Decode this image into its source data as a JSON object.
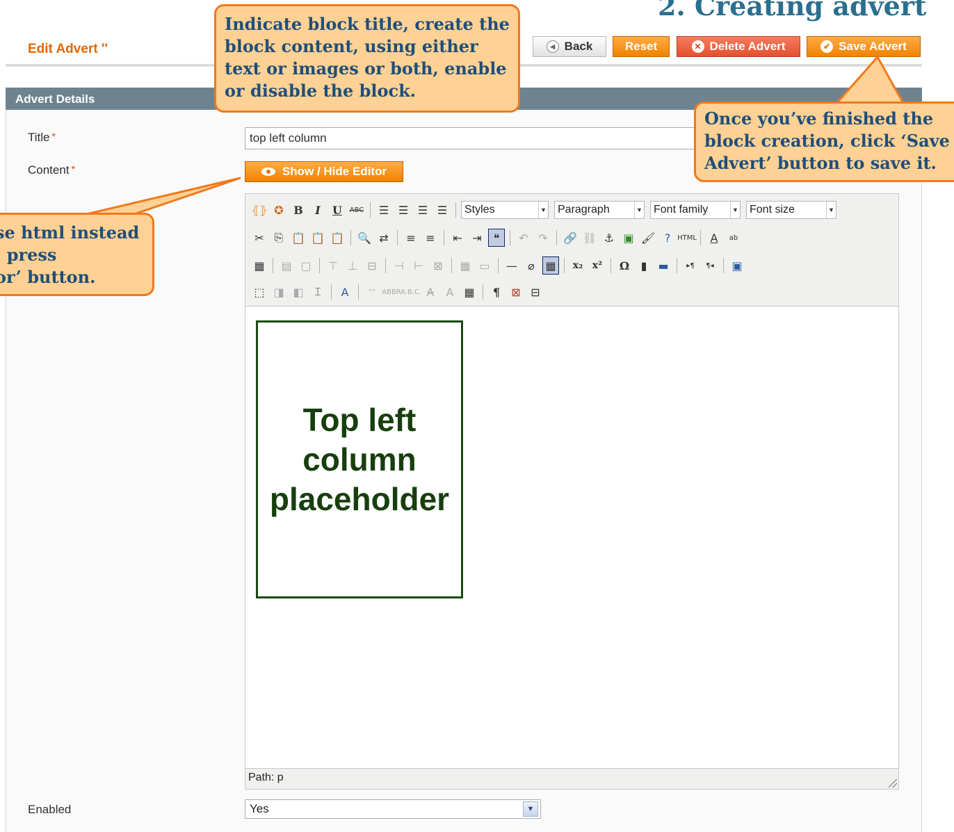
{
  "slide": {
    "title": "2. Creating advert"
  },
  "header": {
    "page_title": "Edit Advert ''"
  },
  "actions": {
    "back": "Back",
    "reset": "Reset",
    "delete": "Delete Advert",
    "save": "Save Advert"
  },
  "section": {
    "title": "Advert Details"
  },
  "form": {
    "title_label": "Title",
    "title_value": "top left column",
    "content_label": "Content",
    "toggle_editor": "Show / Hide Editor",
    "enabled_label": "Enabled",
    "enabled_value": "Yes",
    "required_mark": "*"
  },
  "editor": {
    "styles": "Styles",
    "paragraph": "Paragraph",
    "font_family": "Font family",
    "font_size": "Font size",
    "content_line1": "Top left",
    "content_line2": "column",
    "content_line3": "placeholder",
    "path": "Path: p"
  },
  "callouts": {
    "top": "Indicate block title, create the block content, using either text or images or both, enable or disable the block.",
    "right": "Once you’ve finished the block creation, click ‘Save Advert’ button to save it.",
    "left_line1": "se html instead",
    "left_line2": ", press",
    "left_line3": "or’ button."
  }
}
